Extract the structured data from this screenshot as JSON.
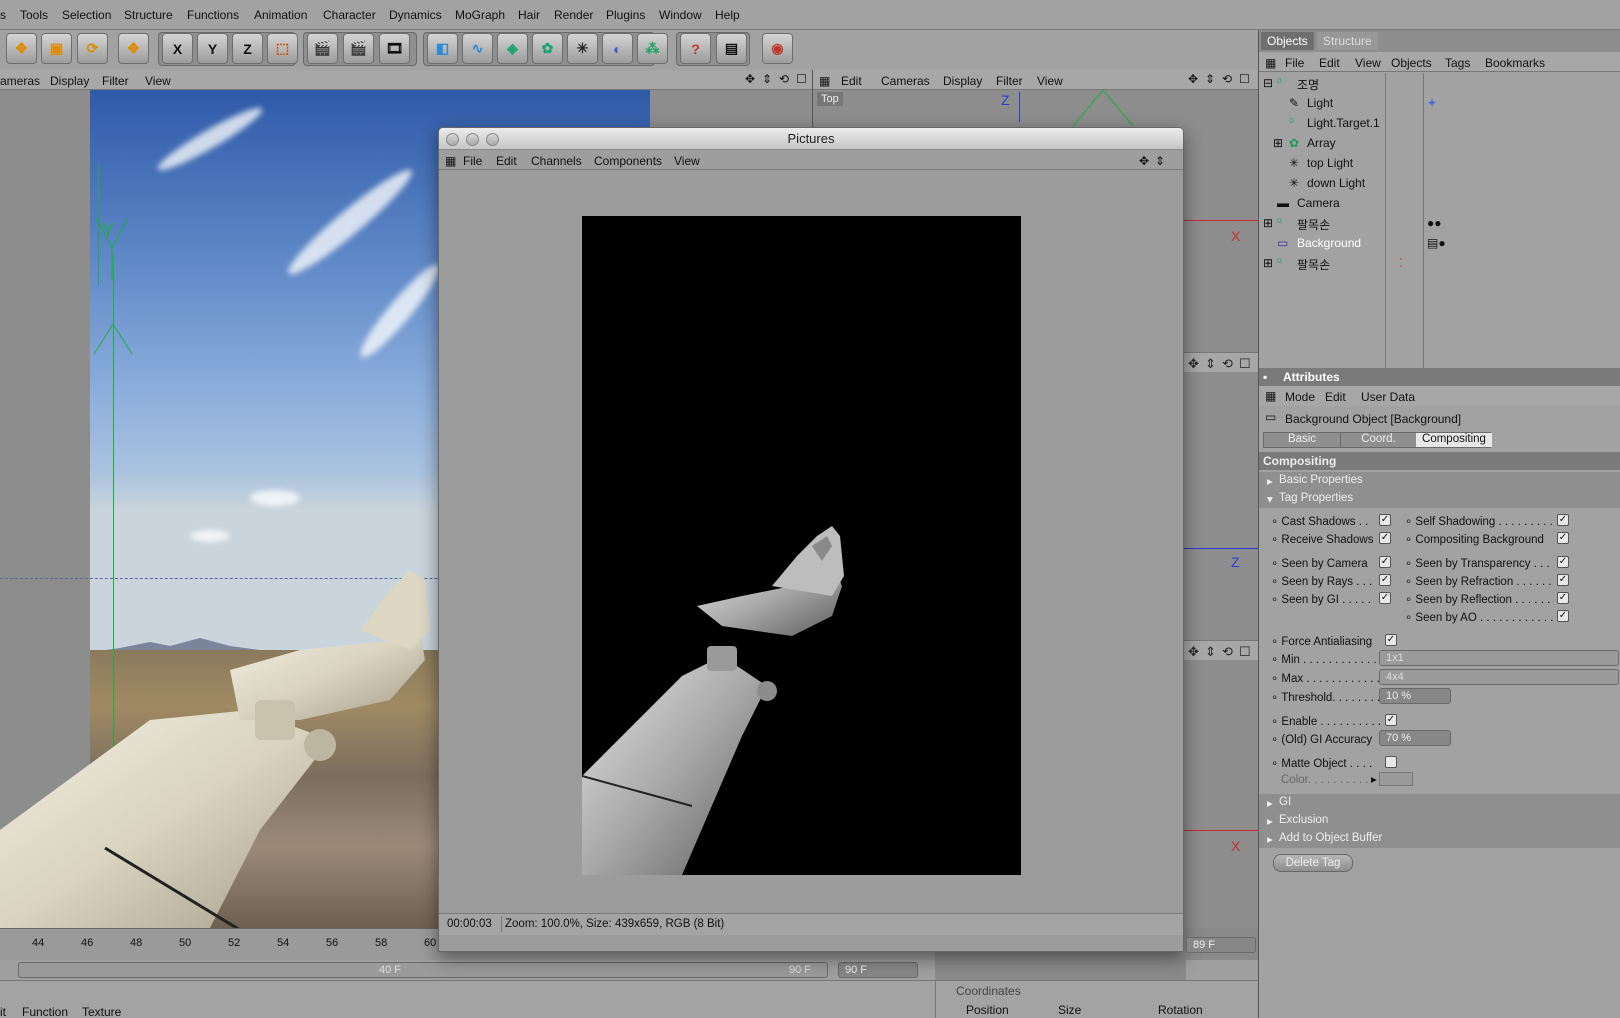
{
  "menubar": [
    "s",
    "Tools",
    "Selection",
    "Structure",
    "Functions",
    "Animation",
    "Character",
    "Dynamics",
    "MoGraph",
    "Hair",
    "Render",
    "Plugins",
    "Window",
    "Help"
  ],
  "left_viewport": {
    "menu": [
      "ameras",
      "Display",
      "Filter",
      "View"
    ]
  },
  "right_viewport": {
    "menu": [
      "Edit",
      "Cameras",
      "Display",
      "Filter",
      "View"
    ],
    "label": "Top",
    "axis_z": "Z",
    "axis_x": "X"
  },
  "axis_labels": {
    "y": "Y"
  },
  "toolbar": {
    "x_label": "X",
    "y_label": "Y",
    "z_label": "Z"
  },
  "timeline": {
    "ticks": [
      "44",
      "46",
      "48",
      "50",
      "52",
      "54",
      "56",
      "58",
      "60"
    ],
    "frame_field": "89 F",
    "end_frame": "90 F",
    "current_frame": "40 F",
    "end_frame2": "90 F"
  },
  "pictures_window": {
    "title": "Pictures",
    "menu": [
      "File",
      "Edit",
      "Channels",
      "Components",
      "View"
    ],
    "status_time": "00:00:03",
    "status_info": "Zoom: 100.0%, Size: 439x659, RGB (8 Bit)"
  },
  "objects_panel": {
    "tabs": [
      "Objects",
      "Structure"
    ],
    "menu": [
      "File",
      "Edit",
      "View",
      "Objects",
      "Tags",
      "Bookmarks"
    ],
    "items": [
      {
        "name": "조명"
      },
      {
        "name": "Light"
      },
      {
        "name": "Light.Target.1"
      },
      {
        "name": "Array"
      },
      {
        "name": "top Light"
      },
      {
        "name": "down Light"
      },
      {
        "name": "Camera"
      },
      {
        "name": "팔목손"
      },
      {
        "name": "Background"
      },
      {
        "name": "팔목손"
      }
    ]
  },
  "attributes": {
    "header": "Attributes",
    "menu": [
      "Mode",
      "Edit",
      "User Data"
    ],
    "object_title": "Background Object [Background]",
    "tabs": [
      "Basic",
      "Coord.",
      "Compositing"
    ],
    "active_tab": "Compositing",
    "section": "Compositing",
    "groups": [
      "Basic Properties",
      "Tag Properties"
    ],
    "left_checks": [
      {
        "label": "Cast Shadows . .",
        "checked": true
      },
      {
        "label": "Receive Shadows",
        "checked": true
      },
      {
        "label": "Seen by Camera",
        "checked": true
      },
      {
        "label": "Seen by Rays . . .",
        "checked": true
      },
      {
        "label": "Seen by GI . . . . .",
        "checked": true
      }
    ],
    "right_checks": [
      {
        "label": "Self Shadowing . . . . . . . . . .",
        "checked": true
      },
      {
        "label": "Compositing Background",
        "checked": true
      },
      {
        "label": "Seen by Transparency . . .",
        "checked": true
      },
      {
        "label": "Seen by Refraction . . . . . .",
        "checked": true
      },
      {
        "label": "Seen by Reflection . . . . . .",
        "checked": true
      },
      {
        "label": "Seen by AO . . . . . . . . . . . .",
        "checked": true
      }
    ],
    "force_aa": {
      "label": "Force Antialiasing",
      "checked": true
    },
    "min": {
      "label": "Min . . . . . . . . . . . . .",
      "value": "1x1"
    },
    "max": {
      "label": "Max . . . . . . . . . . . . .",
      "value": "4x4"
    },
    "threshold": {
      "label": "Threshold. . . . . . . .",
      "value": "10 %"
    },
    "enable": {
      "label": "Enable . . . . . . . . . . .",
      "checked": true
    },
    "gi_accuracy": {
      "label": "(Old) GI Accuracy",
      "value": "70 %"
    },
    "matte": {
      "label": "Matte Object . . . .",
      "checked": false
    },
    "color": {
      "label": "Color. . . . . . . . . ."
    },
    "footer_groups": [
      "GI",
      "Exclusion",
      "Add to Object Buffer"
    ],
    "delete_button": "Delete Tag"
  },
  "bottom_panel": {
    "menu": [
      "it",
      "Function",
      "Texture"
    ],
    "coords_title": "Coordinates",
    "coords_cols": [
      "Position",
      "Size",
      "Rotation"
    ]
  }
}
